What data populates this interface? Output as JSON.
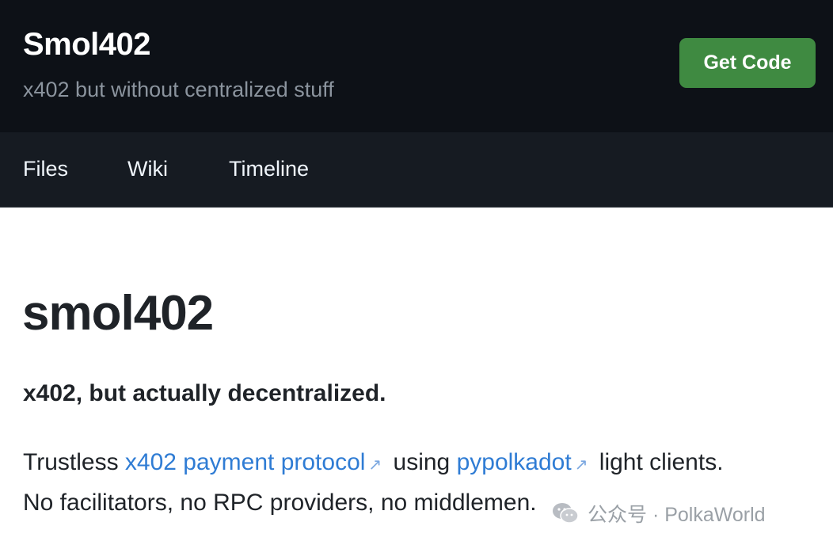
{
  "header": {
    "title": "Smol402",
    "tagline": "x402 but without centralized stuff",
    "get_code_label": "Get Code"
  },
  "nav": {
    "items": [
      {
        "label": "Files"
      },
      {
        "label": "Wiki"
      },
      {
        "label": "Timeline"
      }
    ]
  },
  "content": {
    "title": "smol402",
    "subtitle": "x402, but actually decentralized.",
    "para_text1": "Trustless ",
    "link1": "x402 payment protocol",
    "para_text2": " using ",
    "link2": "pypolkadot",
    "para_text3": " light clients.",
    "para_line2": "No facilitators, no RPC providers, no middlemen."
  },
  "icons": {
    "external_link": "↗",
    "wechat": "wechat-icon"
  },
  "watermark": {
    "text": "公众号 · PolkaWorld"
  },
  "colors": {
    "header_bg": "#0d1117",
    "nav_bg": "#161b22",
    "button_green": "#3f8a41",
    "link_blue": "#2f7cd4",
    "text_dark": "#1f2328"
  }
}
